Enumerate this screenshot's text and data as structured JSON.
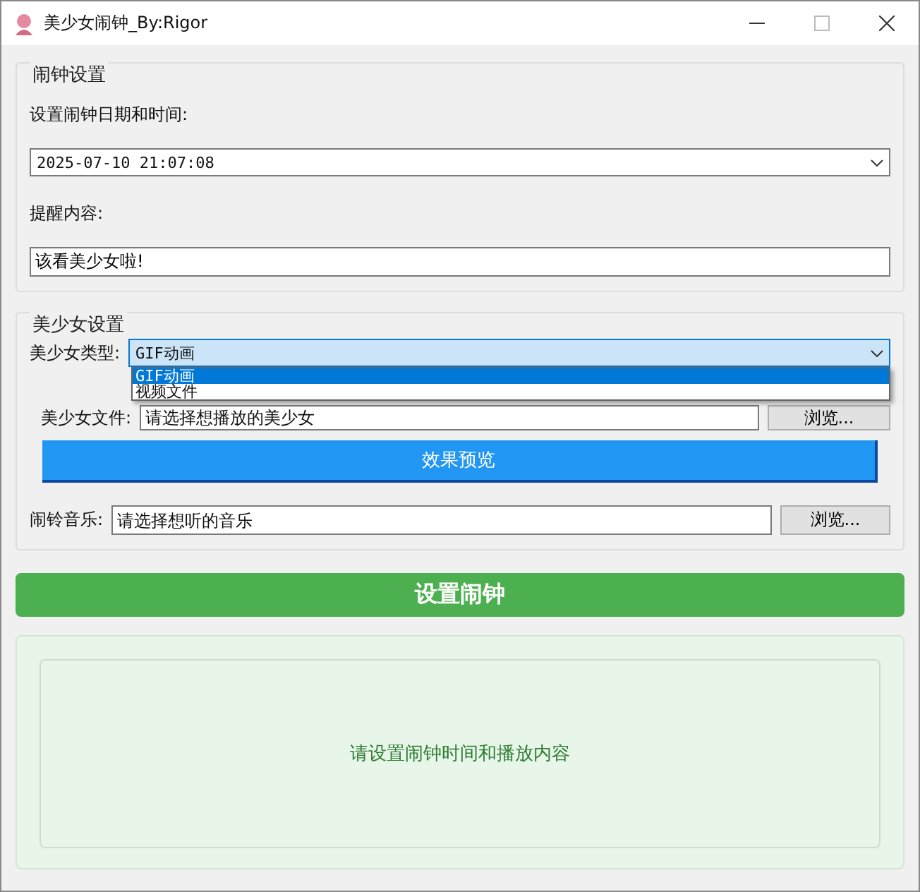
{
  "window": {
    "title": "美少女闹钟_By:Rigor"
  },
  "alarm_settings": {
    "title": "闹钟设置",
    "datetime_label": "设置闹钟日期和时间:",
    "datetime_value": "2025-07-10 21:07:08",
    "message_label": "提醒内容:",
    "message_value": "该看美少女啦!"
  },
  "beauty_settings": {
    "title": "美少女设置",
    "type_label": "美少女类型:",
    "type_value": "GIF动画",
    "expanded": true,
    "options": [
      {
        "label": "GIF动画",
        "selected": true
      },
      {
        "label": "视频文件",
        "selected": false
      }
    ],
    "file_label": "美少女文件:",
    "file_placeholder": "请选择想播放的美少女",
    "file_browse": "浏览...",
    "preview_button": "效果预览",
    "music_label": "闹铃音乐:",
    "music_placeholder": "请选择想听的音乐",
    "music_browse": "浏览..."
  },
  "set_button": "设置闹钟",
  "status": "请设置闹钟时间和播放内容"
}
